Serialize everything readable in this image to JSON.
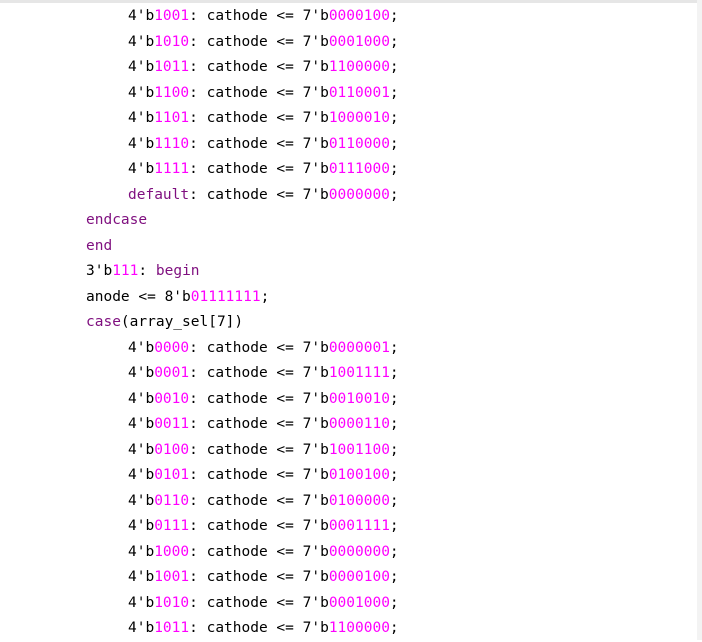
{
  "colors": {
    "background": "#ffffff",
    "keyword": "#7f0f7f",
    "number": "#ff00ff",
    "text": "#000000"
  },
  "code_lines": [
    {
      "indent": 2,
      "parts": [
        {
          "t": "4'b",
          "c": ""
        },
        {
          "t": "1001",
          "c": "num"
        },
        {
          "t": ": cathode <= 7'b",
          "c": ""
        },
        {
          "t": "0000100",
          "c": "num"
        },
        {
          "t": ";",
          "c": ""
        }
      ]
    },
    {
      "indent": 2,
      "parts": [
        {
          "t": "4'b",
          "c": ""
        },
        {
          "t": "1010",
          "c": "num"
        },
        {
          "t": ": cathode <= 7'b",
          "c": ""
        },
        {
          "t": "0001000",
          "c": "num"
        },
        {
          "t": ";",
          "c": ""
        }
      ]
    },
    {
      "indent": 2,
      "parts": [
        {
          "t": "4'b",
          "c": ""
        },
        {
          "t": "1011",
          "c": "num"
        },
        {
          "t": ": cathode <= 7'b",
          "c": ""
        },
        {
          "t": "1100000",
          "c": "num"
        },
        {
          "t": ";",
          "c": ""
        }
      ]
    },
    {
      "indent": 2,
      "parts": [
        {
          "t": "4'b",
          "c": ""
        },
        {
          "t": "1100",
          "c": "num"
        },
        {
          "t": ": cathode <= 7'b",
          "c": ""
        },
        {
          "t": "0110001",
          "c": "num"
        },
        {
          "t": ";",
          "c": ""
        }
      ]
    },
    {
      "indent": 2,
      "parts": [
        {
          "t": "4'b",
          "c": ""
        },
        {
          "t": "1101",
          "c": "num"
        },
        {
          "t": ": cathode <= 7'b",
          "c": ""
        },
        {
          "t": "1000010",
          "c": "num"
        },
        {
          "t": ";",
          "c": ""
        }
      ]
    },
    {
      "indent": 2,
      "parts": [
        {
          "t": "4'b",
          "c": ""
        },
        {
          "t": "1110",
          "c": "num"
        },
        {
          "t": ": cathode <= 7'b",
          "c": ""
        },
        {
          "t": "0110000",
          "c": "num"
        },
        {
          "t": ";",
          "c": ""
        }
      ]
    },
    {
      "indent": 2,
      "parts": [
        {
          "t": "4'b",
          "c": ""
        },
        {
          "t": "1111",
          "c": "num"
        },
        {
          "t": ": cathode <= 7'b",
          "c": ""
        },
        {
          "t": "0111000",
          "c": "num"
        },
        {
          "t": ";",
          "c": ""
        }
      ]
    },
    {
      "indent": 2,
      "parts": [
        {
          "t": "default",
          "c": "kw"
        },
        {
          "t": ": cathode <= 7'b",
          "c": ""
        },
        {
          "t": "0000000",
          "c": "num"
        },
        {
          "t": ";",
          "c": ""
        }
      ]
    },
    {
      "indent": 1,
      "parts": [
        {
          "t": "endcase",
          "c": "kw"
        }
      ]
    },
    {
      "indent": 1,
      "parts": [
        {
          "t": "end",
          "c": "kw"
        }
      ]
    },
    {
      "indent": 1,
      "parts": [
        {
          "t": "3'b",
          "c": ""
        },
        {
          "t": "111",
          "c": "num"
        },
        {
          "t": ": ",
          "c": ""
        },
        {
          "t": "begin",
          "c": "kw"
        }
      ]
    },
    {
      "indent": 1,
      "parts": [
        {
          "t": "anode <= 8'b",
          "c": ""
        },
        {
          "t": "01111111",
          "c": "num"
        },
        {
          "t": ";",
          "c": ""
        }
      ]
    },
    {
      "indent": 1,
      "parts": [
        {
          "t": "case",
          "c": "kw"
        },
        {
          "t": "(array_sel[7])",
          "c": ""
        }
      ]
    },
    {
      "indent": 2,
      "parts": [
        {
          "t": "4'b",
          "c": ""
        },
        {
          "t": "0000",
          "c": "num"
        },
        {
          "t": ": cathode <= 7'b",
          "c": ""
        },
        {
          "t": "0000001",
          "c": "num"
        },
        {
          "t": ";",
          "c": ""
        }
      ]
    },
    {
      "indent": 2,
      "parts": [
        {
          "t": "4'b",
          "c": ""
        },
        {
          "t": "0001",
          "c": "num"
        },
        {
          "t": ": cathode <= 7'b",
          "c": ""
        },
        {
          "t": "1001111",
          "c": "num"
        },
        {
          "t": ";",
          "c": ""
        }
      ]
    },
    {
      "indent": 2,
      "parts": [
        {
          "t": "4'b",
          "c": ""
        },
        {
          "t": "0010",
          "c": "num"
        },
        {
          "t": ": cathode <= 7'b",
          "c": ""
        },
        {
          "t": "0010010",
          "c": "num"
        },
        {
          "t": ";",
          "c": ""
        }
      ]
    },
    {
      "indent": 2,
      "parts": [
        {
          "t": "4'b",
          "c": ""
        },
        {
          "t": "0011",
          "c": "num"
        },
        {
          "t": ": cathode <= 7'b",
          "c": ""
        },
        {
          "t": "0000110",
          "c": "num"
        },
        {
          "t": ";",
          "c": ""
        }
      ]
    },
    {
      "indent": 2,
      "parts": [
        {
          "t": "4'b",
          "c": ""
        },
        {
          "t": "0100",
          "c": "num"
        },
        {
          "t": ": cathode <= 7'b",
          "c": ""
        },
        {
          "t": "1001100",
          "c": "num"
        },
        {
          "t": ";",
          "c": ""
        }
      ]
    },
    {
      "indent": 2,
      "parts": [
        {
          "t": "4'b",
          "c": ""
        },
        {
          "t": "0101",
          "c": "num"
        },
        {
          "t": ": cathode <= 7'b",
          "c": ""
        },
        {
          "t": "0100100",
          "c": "num"
        },
        {
          "t": ";",
          "c": ""
        }
      ]
    },
    {
      "indent": 2,
      "parts": [
        {
          "t": "4'b",
          "c": ""
        },
        {
          "t": "0110",
          "c": "num"
        },
        {
          "t": ": cathode <= 7'b",
          "c": ""
        },
        {
          "t": "0100000",
          "c": "num"
        },
        {
          "t": ";",
          "c": ""
        }
      ]
    },
    {
      "indent": 2,
      "parts": [
        {
          "t": "4'b",
          "c": ""
        },
        {
          "t": "0111",
          "c": "num"
        },
        {
          "t": ": cathode <= 7'b",
          "c": ""
        },
        {
          "t": "0001111",
          "c": "num"
        },
        {
          "t": ";",
          "c": ""
        }
      ]
    },
    {
      "indent": 2,
      "parts": [
        {
          "t": "4'b",
          "c": ""
        },
        {
          "t": "1000",
          "c": "num"
        },
        {
          "t": ": cathode <= 7'b",
          "c": ""
        },
        {
          "t": "0000000",
          "c": "num"
        },
        {
          "t": ";",
          "c": ""
        }
      ]
    },
    {
      "indent": 2,
      "parts": [
        {
          "t": "4'b",
          "c": ""
        },
        {
          "t": "1001",
          "c": "num"
        },
        {
          "t": ": cathode <= 7'b",
          "c": ""
        },
        {
          "t": "0000100",
          "c": "num"
        },
        {
          "t": ";",
          "c": ""
        }
      ]
    },
    {
      "indent": 2,
      "parts": [
        {
          "t": "4'b",
          "c": ""
        },
        {
          "t": "1010",
          "c": "num"
        },
        {
          "t": ": cathode <= 7'b",
          "c": ""
        },
        {
          "t": "0001000",
          "c": "num"
        },
        {
          "t": ";",
          "c": ""
        }
      ]
    },
    {
      "indent": 2,
      "parts": [
        {
          "t": "4'b",
          "c": ""
        },
        {
          "t": "1011",
          "c": "num"
        },
        {
          "t": ": cathode <= 7'b",
          "c": ""
        },
        {
          "t": "1100000",
          "c": "num"
        },
        {
          "t": ";",
          "c": ""
        }
      ]
    }
  ]
}
